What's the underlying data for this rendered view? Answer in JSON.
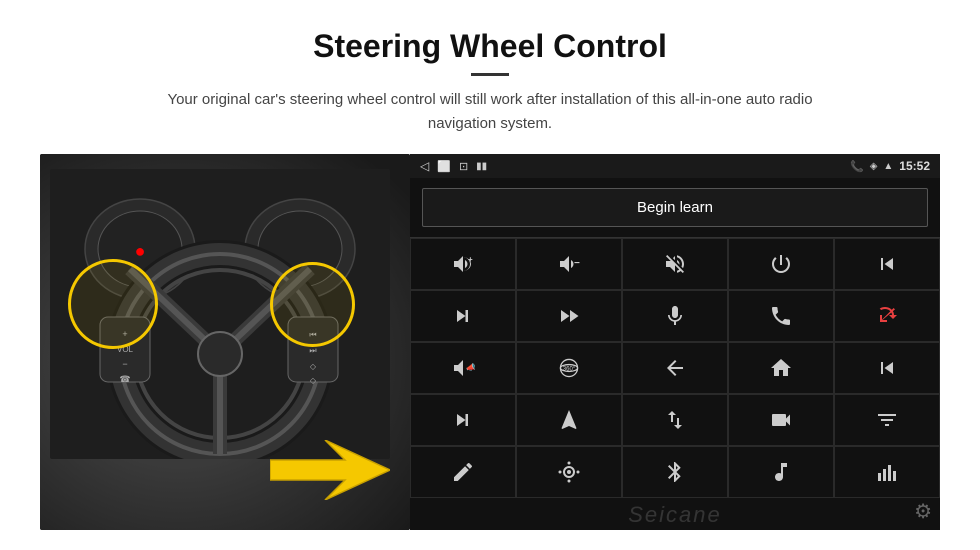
{
  "header": {
    "title": "Steering Wheel Control",
    "subtitle": "Your original car's steering wheel control will still work after installation of this all-in-one auto radio navigation system.",
    "divider": ""
  },
  "status_bar": {
    "back_icon": "◁",
    "home_icon": "□",
    "window_icon": "⊡",
    "signal_icon": "▮▮",
    "phone_icon": "📞",
    "location_icon": "◈",
    "wifi_icon": "▲",
    "time": "15:52"
  },
  "begin_learn": {
    "label": "Begin learn"
  },
  "grid": {
    "cells": [
      {
        "icon": "vol_up",
        "unicode": "🔊+"
      },
      {
        "icon": "vol_down",
        "unicode": "🔊−"
      },
      {
        "icon": "vol_mute",
        "unicode": "🔇"
      },
      {
        "icon": "power",
        "unicode": "⏻"
      },
      {
        "icon": "prev_track",
        "unicode": "⏮"
      },
      {
        "icon": "next_track",
        "unicode": "⏭"
      },
      {
        "icon": "ff",
        "unicode": "⏩⏩"
      },
      {
        "icon": "mic",
        "unicode": "🎤"
      },
      {
        "icon": "phone",
        "unicode": "📞"
      },
      {
        "icon": "phone_end",
        "unicode": "📵"
      },
      {
        "icon": "horn",
        "unicode": "📣"
      },
      {
        "icon": "360",
        "unicode": "360°"
      },
      {
        "icon": "back",
        "unicode": "↩"
      },
      {
        "icon": "home",
        "unicode": "⌂"
      },
      {
        "icon": "skip_back",
        "unicode": "⏮"
      },
      {
        "icon": "fast_fwd",
        "unicode": "⏭"
      },
      {
        "icon": "nav",
        "unicode": "▲"
      },
      {
        "icon": "swap",
        "unicode": "⇄"
      },
      {
        "icon": "cam",
        "unicode": "📷"
      },
      {
        "icon": "eq",
        "unicode": "🎚"
      },
      {
        "icon": "pen",
        "unicode": "✏"
      },
      {
        "icon": "settings_dot",
        "unicode": "⚙"
      },
      {
        "icon": "bluetooth",
        "unicode": "ʙ"
      },
      {
        "icon": "music",
        "unicode": "♪"
      },
      {
        "icon": "bars",
        "unicode": "📶"
      }
    ]
  },
  "watermark": "Seicane",
  "gear_icon": "⚙"
}
